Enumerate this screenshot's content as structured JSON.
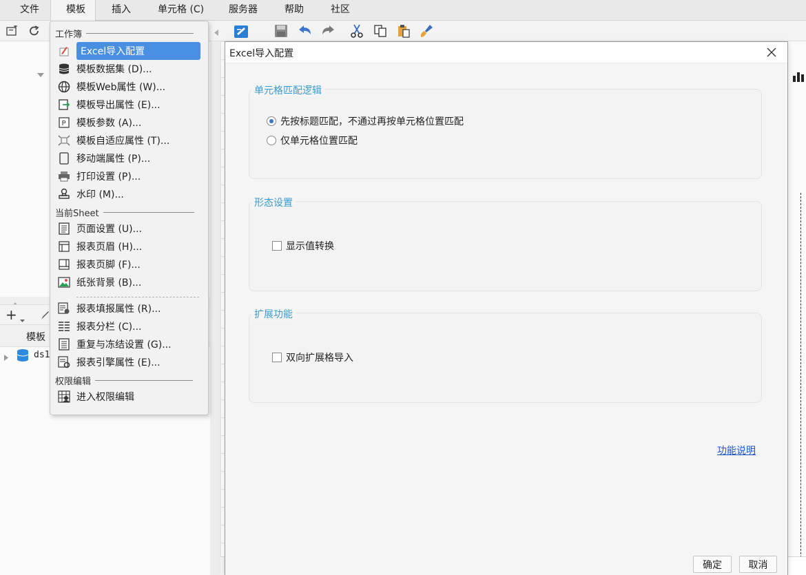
{
  "menubar": {
    "items": [
      {
        "label": "文件"
      },
      {
        "label": "模板"
      },
      {
        "label": "插入"
      },
      {
        "label": "单元格 (C)"
      },
      {
        "label": "服务器"
      },
      {
        "label": "帮助"
      },
      {
        "label": "社区"
      }
    ]
  },
  "left_panel": {
    "tab_label": "模板",
    "dataset_item": "ds1"
  },
  "dropdown": {
    "sections": {
      "workbook": "工作簿",
      "current_sheet": "当前Sheet",
      "permission": "权限编辑"
    },
    "items": [
      {
        "label": "Excel导入配置",
        "icon": "excel-import-icon"
      },
      {
        "label": "模板数据集 (D)...",
        "icon": "database-icon"
      },
      {
        "label": "模板Web属性 (W)...",
        "icon": "globe-icon"
      },
      {
        "label": "模板导出属性 (E)...",
        "icon": "export-icon"
      },
      {
        "label": "模板参数 (A)...",
        "icon": "parameter-icon"
      },
      {
        "label": "模板自适应属性 (T)...",
        "icon": "fit-icon"
      },
      {
        "label": "移动端属性 (P)...",
        "icon": "mobile-icon"
      },
      {
        "label": "打印设置 (P)...",
        "icon": "printer-icon"
      },
      {
        "label": "水印 (M)...",
        "icon": "stamp-icon"
      },
      {
        "label": "页面设置 (U)...",
        "icon": "page-setup-icon"
      },
      {
        "label": "报表页眉 (H)...",
        "icon": "header-icon"
      },
      {
        "label": "报表页脚 (F)...",
        "icon": "footer-icon"
      },
      {
        "label": "纸张背景 (B)...",
        "icon": "background-image-icon"
      },
      {
        "label": "报表填报属性 (R)...",
        "icon": "fill-report-icon"
      },
      {
        "label": "报表分栏 (C)...",
        "icon": "columns-icon"
      },
      {
        "label": "重复与冻结设置 (G)...",
        "icon": "freeze-icon"
      },
      {
        "label": "报表引擎属性 (E)...",
        "icon": "engine-icon"
      },
      {
        "label": "进入权限编辑",
        "icon": "permission-icon"
      }
    ]
  },
  "dialog": {
    "title": "Excel导入配置",
    "group1": {
      "title": "单元格匹配逻辑",
      "option1": "先按标题匹配，不通过再按单元格位置匹配",
      "option2": "仅单元格位置匹配",
      "selected": 1
    },
    "group2": {
      "title": "形态设置",
      "checkbox": "显示值转换",
      "checked": false
    },
    "group3": {
      "title": "扩展功能",
      "checkbox": "双向扩展格导入",
      "checked": false
    },
    "help_link": "功能说明",
    "ok_label": "确定",
    "cancel_label": "取消"
  },
  "grid": {
    "visible_row_number": "23"
  },
  "colors": {
    "accent": "#3a9bd3",
    "selection": "#4a90e2",
    "link": "#1c56c6"
  }
}
